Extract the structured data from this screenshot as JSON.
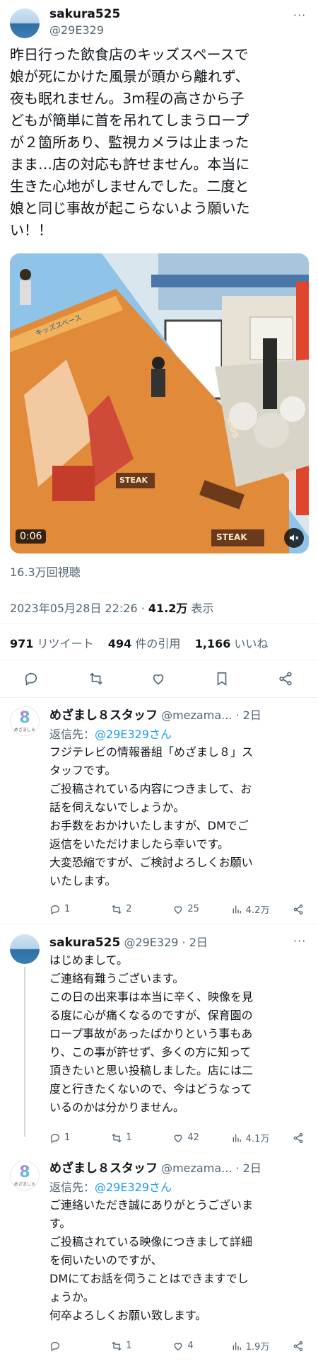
{
  "main_post": {
    "name": "sakura525",
    "handle": "@29E329",
    "text": "昨日行った飲食店のキッズスペースで\n娘が死にかけた風景が頭から離れず、\n夜も眠れません。3m程の高さから子\nどもが簡単に首を吊れてしまうロープ\nが２箇所あり、監視カメラは止まった\nまま…店の対応も許せません。本当に\n生きた心地がしませんでした。二度と\n娘と同じ事故が起こらないよう願いた\nい！！",
    "video": {
      "duration": "0:06",
      "sign1": "KIDS",
      "sign2": "STEAK",
      "sign3": "STEAK",
      "sign4": "キッズスペース"
    },
    "views": "16.3万回視聴",
    "date": "2023年05月28日 22:26",
    "separator": "·",
    "impressions": "41.2万",
    "impressions_label": "表示",
    "stats": {
      "retweets": "971",
      "retweets_label": "リツイート",
      "quotes": "494",
      "quotes_label": "件の引用",
      "likes": "1,166",
      "likes_label": "いいね"
    }
  },
  "replies": [
    {
      "name": "めざまし８スタッフ",
      "handle": "@mezama...",
      "time": "· 2日",
      "reply_to_label": "返信先：",
      "reply_to_handle": "@29E329さん",
      "text": "フジテレビの情報番組「めざまし８」ス\nタッフです。\nご投稿されている内容につきまして、お\n話を伺えないでしょうか。\nお手数をおかけいたしますが、DMでご\n返信をいただけましたら幸いです。\n大変恐縮ですが、ご検討よろしくお願い\nいたします。",
      "replies": "1",
      "retweets": "2",
      "likes": "25",
      "views": "4.2万"
    },
    {
      "name": "sakura525",
      "handle": "@29E329",
      "time": "· 2日",
      "text": "はじめまして。\nご連絡有難うございます。\nこの日の出来事は本当に辛く、映像を見\nる度に心が痛くなるのですが、保育園の\nロープ事故があったばかりという事もあ\nり、この事が許せず、多くの方に知って\n頂きたいと思い投稿しました。店には二\n度と行きたくないので、今はどうなって\nいるのかは分かりません。",
      "replies": "1",
      "retweets": "1",
      "likes": "42",
      "views": "4.1万"
    },
    {
      "name": "めざまし８スタッフ",
      "handle": "@mezama...",
      "time": "· 2日",
      "reply_to_label": "返信先：",
      "reply_to_handle": "@29E329さん",
      "text": "ご連絡いただき誠にありがとうございま\nす。\nご投稿されている映像につきまして詳細\nを伺いたいのですが、\nDMにてお話を伺うことはできますでし\nょうか。\n何卒よろしくお願い致します。",
      "replies": "",
      "retweets": "1",
      "likes": "4",
      "views": "1.9万"
    }
  ],
  "logo_text": {
    "big": "8",
    "small": "めざまし８"
  },
  "colors": {
    "link": "#1d9bf0",
    "muted": "#536471",
    "divider": "#eff3f4"
  },
  "icons": [
    "reply-icon",
    "retweet-icon",
    "like-icon",
    "bookmark-icon",
    "share-icon",
    "views-icon",
    "mute-icon"
  ]
}
